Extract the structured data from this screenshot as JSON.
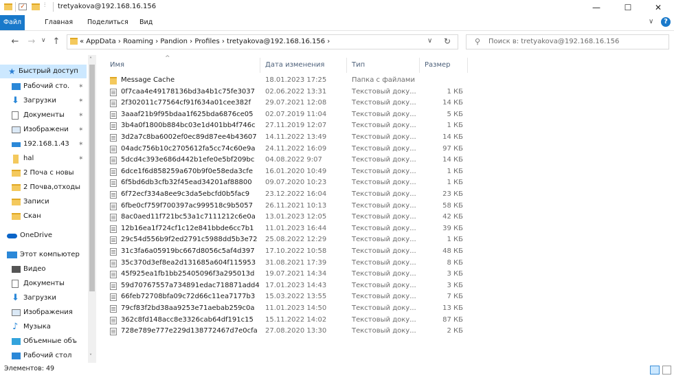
{
  "window": {
    "title": "tretyakova@192.168.16.156",
    "quick_access_dropdown": "⫶",
    "minimize": "—",
    "maximize": "☐",
    "close": "✕"
  },
  "ribbon": {
    "tabs": [
      "Файл",
      "Главная",
      "Поделиться",
      "Вид"
    ],
    "active_tab_color": "#1979ca",
    "expand_icon": "∨",
    "help_icon": "?"
  },
  "address": {
    "back": "←",
    "forward": "→",
    "up": "↑",
    "crumbs": "«  AppData  ›  Roaming  ›  Pandion  ›  Profiles  ›  tretyakova@192.168.16.156  ›",
    "dropdown": "∨",
    "refresh": "↻"
  },
  "search": {
    "placeholder": "Поиск в: tretyakova@192.168.16.156"
  },
  "nav": {
    "items": [
      {
        "label": "Быстрый доступ",
        "icon": "star-icon",
        "pinned": false,
        "selected": true
      },
      {
        "label": "Рабочий сто.",
        "icon": "desktop-icon",
        "pinned": true
      },
      {
        "label": "Загрузки",
        "icon": "download-icon",
        "pinned": true
      },
      {
        "label": "Документы",
        "icon": "documents-icon",
        "pinned": true
      },
      {
        "label": "Изображени",
        "icon": "pictures-icon",
        "pinned": true
      },
      {
        "label": "192.168.1.43",
        "icon": "network-drive-icon",
        "pinned": true
      },
      {
        "label": "hal",
        "icon": "hal-icon",
        "pinned": true
      },
      {
        "label": "2 Поча с новы",
        "icon": "folder-icon",
        "pinned": false
      },
      {
        "label": "2 Почва,отходы",
        "icon": "folder-icon",
        "pinned": false
      },
      {
        "label": "Записи",
        "icon": "folder-icon",
        "pinned": false
      },
      {
        "label": "Скан",
        "icon": "folder-icon",
        "pinned": false
      },
      {
        "label": "OneDrive",
        "icon": "cloud-icon",
        "pinned": false
      },
      {
        "label": "Этот компьютер",
        "icon": "computer-icon",
        "pinned": false
      },
      {
        "label": "Видео",
        "icon": "video-icon",
        "pinned": false
      },
      {
        "label": "Документы",
        "icon": "documents-icon",
        "pinned": false
      },
      {
        "label": "Загрузки",
        "icon": "download-icon",
        "pinned": false
      },
      {
        "label": "Изображения",
        "icon": "pictures-icon",
        "pinned": false
      },
      {
        "label": "Музыка",
        "icon": "music-icon",
        "pinned": false
      },
      {
        "label": "Объемные объ",
        "icon": "3d-objects-icon",
        "pinned": false
      },
      {
        "label": "Рабочий стол",
        "icon": "desktop-icon",
        "pinned": false
      }
    ]
  },
  "columns": {
    "name": "Имя",
    "date": "Дата изменения",
    "type": "Тип",
    "size": "Размер",
    "sort_indicator": "^"
  },
  "files": [
    {
      "name": "Message Cache",
      "date": "18.01.2023 17:25",
      "type": "Папка с файлами",
      "size": "",
      "folder": true
    },
    {
      "name": "0f7caa4e49178136bd3a4b1c75fe3037",
      "date": "02.06.2022 13:31",
      "type": "Текстовый доку...",
      "size": "1 КБ"
    },
    {
      "name": "2f302011c77564cf91f634a01cee382f",
      "date": "29.07.2021 12:08",
      "type": "Текстовый доку...",
      "size": "14 КБ"
    },
    {
      "name": "3aaaf21b9f95bdaa1f625bda6876ce05",
      "date": "02.07.2019 11:04",
      "type": "Текстовый доку...",
      "size": "5 КБ"
    },
    {
      "name": "3b4a0f1800b884bc03e1d401bb4f746c",
      "date": "27.11.2019 12:07",
      "type": "Текстовый доку...",
      "size": "1 КБ"
    },
    {
      "name": "3d2a7c8ba6002ef0ec89d87ee4b43607",
      "date": "14.11.2022 13:49",
      "type": "Текстовый доку...",
      "size": "14 КБ"
    },
    {
      "name": "04adc756b10c2705612fa5cc74c60e9a",
      "date": "24.11.2022 16:09",
      "type": "Текстовый доку...",
      "size": "97 КБ"
    },
    {
      "name": "5dcd4c393e686d442b1efe0e5bf209bc",
      "date": "04.08.2022 9:07",
      "type": "Текстовый доку...",
      "size": "14 КБ"
    },
    {
      "name": "6dce1f6d858259a670b9f0e58eda3cfe",
      "date": "16.01.2020 10:49",
      "type": "Текстовый доку...",
      "size": "1 КБ"
    },
    {
      "name": "6f5bd6db3cfb32f45ead34201af88800",
      "date": "09.07.2020 10:23",
      "type": "Текстовый доку...",
      "size": "1 КБ"
    },
    {
      "name": "6f72ecf334a8ee9c3da5ebcfd0b5fac9",
      "date": "23.12.2022 16:04",
      "type": "Текстовый доку...",
      "size": "23 КБ"
    },
    {
      "name": "6fbe0cf759f700397ac999518c9b5057",
      "date": "26.11.2021 10:13",
      "type": "Текстовый доку...",
      "size": "58 КБ"
    },
    {
      "name": "8ac0aed11f721bc53a1c7111212c6e0a",
      "date": "13.01.2023 12:05",
      "type": "Текстовый доку...",
      "size": "42 КБ"
    },
    {
      "name": "12b16ea1f724cf1c12e841bbde6cc7b1",
      "date": "11.01.2023 16:44",
      "type": "Текстовый доку...",
      "size": "39 КБ"
    },
    {
      "name": "29c54d556b9f2ed2791c5988dd5b3e72",
      "date": "25.08.2022 12:29",
      "type": "Текстовый доку...",
      "size": "1 КБ"
    },
    {
      "name": "31c3fa6a05919bc667d8056c5af4d397",
      "date": "17.10.2022 10:58",
      "type": "Текстовый доку...",
      "size": "48 КБ"
    },
    {
      "name": "35c370d3ef8ea2d131685a604f115953",
      "date": "31.08.2021 17:39",
      "type": "Текстовый доку...",
      "size": "8 КБ"
    },
    {
      "name": "45f925ea1fb1bb25405096f3a295013d",
      "date": "19.07.2021 14:34",
      "type": "Текстовый доку...",
      "size": "3 КБ"
    },
    {
      "name": "59d70767557a734891edac718871add4",
      "date": "17.01.2023 14:43",
      "type": "Текстовый доку...",
      "size": "3 КБ"
    },
    {
      "name": "66feb72708bfa09c72d66c11ea7177b3",
      "date": "15.03.2022 13:55",
      "type": "Текстовый доку...",
      "size": "7 КБ"
    },
    {
      "name": "79cf83f2bd38aa9253e71aebab259c0a",
      "date": "11.01.2023 14:50",
      "type": "Текстовый доку...",
      "size": "13 КБ"
    },
    {
      "name": "362c8fd148acc8e3326cab64df191c15",
      "date": "15.11.2022 14:02",
      "type": "Текстовый доку...",
      "size": "87 КБ"
    },
    {
      "name": "728e789e777e229d138772467d7e0cfa",
      "date": "27.08.2020 13:30",
      "type": "Текстовый доку...",
      "size": "2 КБ"
    }
  ],
  "status": {
    "text": "Элементов: 49"
  },
  "colors": {
    "accent": "#1979ca",
    "selected_bg": "#cce8ff",
    "folder": "#f4c95d",
    "header_text": "#4c607a"
  }
}
